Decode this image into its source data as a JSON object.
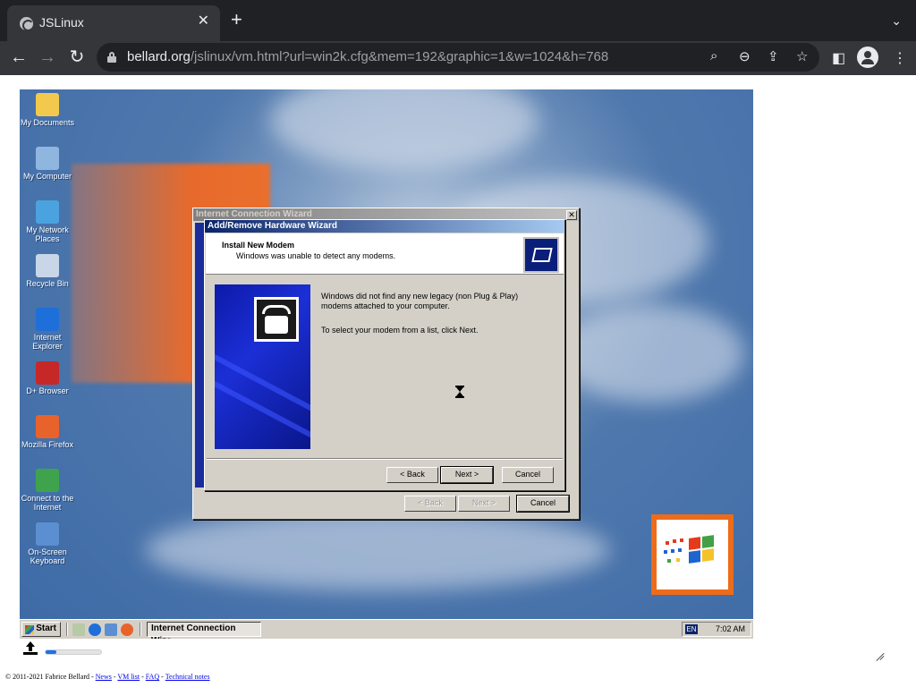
{
  "browser": {
    "tab_title": "JSLinux",
    "tab_close": "✕",
    "new_tab": "+",
    "url_host": "bellard.org",
    "url_path": "/jslinux/vm.html?url=win2k.cfg&mem=192&graphic=1&w=1024&h=768"
  },
  "desktop": {
    "icons": [
      {
        "label": "My Documents",
        "icon": "folder-icon",
        "color": "#f2c94c"
      },
      {
        "label": "My Computer",
        "icon": "computer-icon",
        "color": "#8fb6de"
      },
      {
        "label": "My Network Places",
        "icon": "network-icon",
        "color": "#4aa3df"
      },
      {
        "label": "Recycle Bin",
        "icon": "recycle-bin-icon",
        "color": "#c9d6e8"
      },
      {
        "label": "Internet Explorer",
        "icon": "internet-explorer-icon",
        "color": "#1e6fd9"
      },
      {
        "label": "D+ Browser",
        "icon": "dplus-browser-icon",
        "color": "#c62828"
      },
      {
        "label": "Mozilla Firefox",
        "icon": "firefox-icon",
        "color": "#e8632b"
      },
      {
        "label": "Connect to the Internet",
        "icon": "connect-icon",
        "color": "#3fa34d"
      },
      {
        "label": "On-Screen Keyboard",
        "icon": "keyboard-icon",
        "color": "#5b8fd1"
      }
    ]
  },
  "icw": {
    "title": "Internet Connection Wizard",
    "back": "< Back",
    "next": "Next >",
    "cancel": "Cancel"
  },
  "wizard": {
    "title": "Add/Remove Hardware Wizard",
    "heading": "Install New Modem",
    "subheading": "Windows was unable to detect any modems.",
    "message1": "Windows did not find any new legacy (non Plug & Play) modems attached to your computer.",
    "message2": "To select your modem from a list, click Next.",
    "back": "< Back",
    "next": "Next >",
    "cancel": "Cancel"
  },
  "taskbar": {
    "start": "Start",
    "task_label": "Internet Connection Wiza...",
    "language": "EN",
    "clock": "7:02 AM"
  },
  "page": {
    "upload_progress": 0.2,
    "footer_copyright": "© 2011-2021 Fabrice Bellard - ",
    "footer_news": "News",
    "footer_vmlist": "VM list",
    "footer_faq": "FAQ",
    "footer_technotes": "Technical notes",
    "sep": " - "
  },
  "colors": {
    "accent_blue": "#0a246a",
    "windows_orange": "#ec6c1a"
  }
}
